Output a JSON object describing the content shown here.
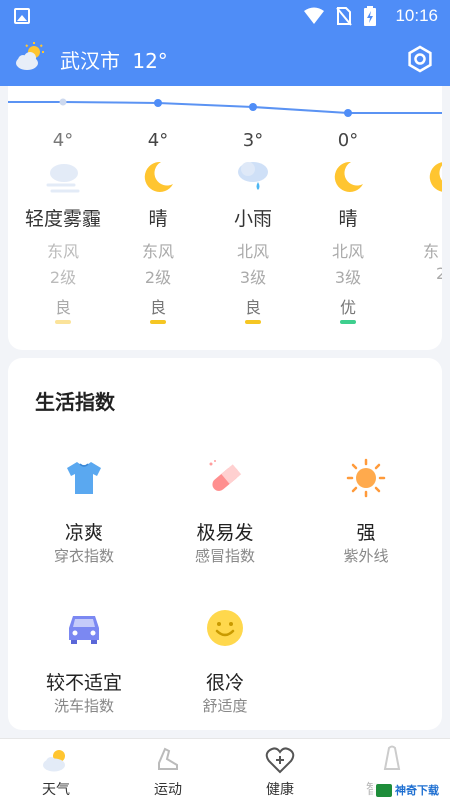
{
  "status_bar": {
    "time": "10:16"
  },
  "app_bar": {
    "city": "武汉市",
    "temperature": "12°"
  },
  "forecast": [
    {
      "temp": "4°",
      "condition": "轻度雾霾",
      "wind_dir": "东风",
      "wind_level": "2级",
      "aqi": "良",
      "aqi_color": "#f5c623",
      "icon": "haze-icon"
    },
    {
      "temp": "4°",
      "condition": "晴",
      "wind_dir": "东风",
      "wind_level": "2级",
      "aqi": "良",
      "aqi_color": "#f5c623",
      "icon": "moon-icon"
    },
    {
      "temp": "3°",
      "condition": "小雨",
      "wind_dir": "北风",
      "wind_level": "3级",
      "aqi": "良",
      "aqi_color": "#f5c623",
      "icon": "light-rain-icon"
    },
    {
      "temp": "0°",
      "condition": "晴",
      "wind_dir": "北风",
      "wind_level": "3级",
      "aqi": "优",
      "aqi_color": "#3ecf8e",
      "icon": "moon-icon"
    },
    {
      "temp": "",
      "condition": "",
      "wind_dir": "东",
      "wind_level": "2",
      "aqi": "",
      "aqi_color": "#f5c623",
      "icon": "moon-icon"
    }
  ],
  "life_index": {
    "title": "生活指数",
    "items": [
      {
        "value": "凉爽",
        "label": "穿衣指数",
        "icon": "tshirt-icon"
      },
      {
        "value": "极易发",
        "label": "感冒指数",
        "icon": "pill-icon"
      },
      {
        "value": "强",
        "label": "紫外线",
        "icon": "sun-icon"
      },
      {
        "value": "较不适宜",
        "label": "洗车指数",
        "icon": "car-icon"
      },
      {
        "value": "很冷",
        "label": "舒适度",
        "icon": "smiley-icon"
      }
    ]
  },
  "bottom_nav": [
    {
      "label": "天气",
      "icon": "weather-icon"
    },
    {
      "label": "运动",
      "icon": "shoe-icon"
    },
    {
      "label": "健康",
      "icon": "heart-plus-icon"
    },
    {
      "label": "智",
      "icon": "smart-icon"
    }
  ],
  "watermark": {
    "text": "神奇下载"
  },
  "colors": {
    "primary": "#4f8df7",
    "aqi_good": "#f5c623",
    "aqi_excellent": "#3ecf8e"
  }
}
